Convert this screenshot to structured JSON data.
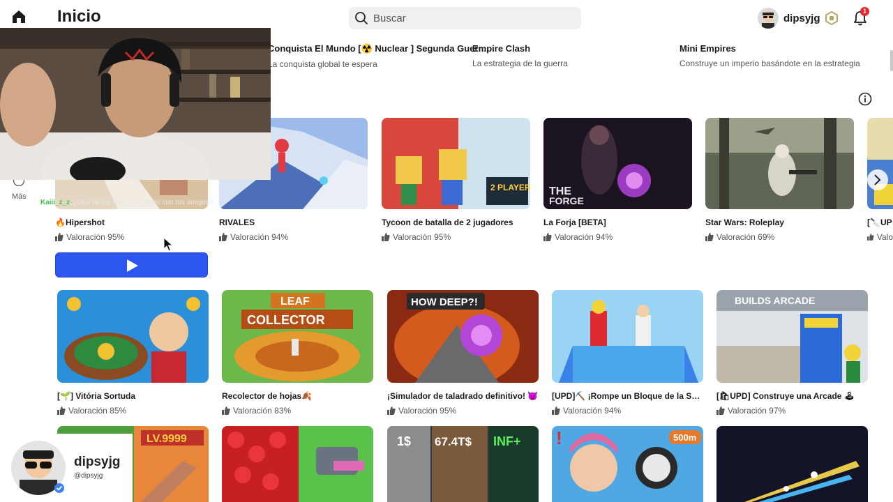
{
  "header": {
    "title": "Inicio",
    "search_placeholder": "Buscar",
    "username": "dipsyjg",
    "notification_count": "1"
  },
  "top_strip": [
    {
      "title": "Conquista El Mundo [☢️ Nuclear ] Segunda Guerr...",
      "subtitle": "La conquista global te espera"
    },
    {
      "title": "Empire Clash",
      "subtitle": "La estrategia de la guerra"
    },
    {
      "title": "Mini Empires",
      "subtitle": "Construye un imperio basándote en la estrategia"
    }
  ],
  "sidebar": {
    "more_label": "Más"
  },
  "chat": {
    "user": "Kaiii_z_z",
    "message": "¿Que tal los dias que saliste con tus amigos?"
  },
  "row1": [
    {
      "title": "🔥Hipershot",
      "rating": "Valoración 95%",
      "colors": [
        "#d9b48a",
        "#f4efe6"
      ]
    },
    {
      "title": "RIVALES",
      "rating": "Valoración 94%",
      "colors": [
        "#4f7fd8",
        "#d8e4f6"
      ]
    },
    {
      "title": "Tycoon de batalla de 2 jugadores",
      "rating": "Valoración 95%",
      "colors": [
        "#d7453c",
        "#f5c84a"
      ]
    },
    {
      "title": "La Forja [BETA]",
      "rating": "Valoración 94%",
      "colors": [
        "#1e1624",
        "#6a3c7e"
      ]
    },
    {
      "title": "Star Wars: Roleplay",
      "rating": "Valoración 69%",
      "colors": [
        "#3e4a3c",
        "#9aa285"
      ]
    },
    {
      "title": "[🔪UP",
      "rating": "Valo",
      "colors": [
        "#e3d7a8",
        "#4a7fd0"
      ]
    }
  ],
  "row2": [
    {
      "title": "[🌱] Vitória Sortuda",
      "rating": "Valoración 85%",
      "colors": [
        "#2b90d9",
        "#f2c230"
      ]
    },
    {
      "title": "Recolector de hojas🍂",
      "rating": "Valoración 83%",
      "colors": [
        "#5aa63f",
        "#e49a2c"
      ]
    },
    {
      "title": "¡Simulador de taladrado definitivo! 😈",
      "rating": "Valoración 95%",
      "colors": [
        "#c3461f",
        "#b246d6"
      ]
    },
    {
      "title": "[UPD]⛏️ ¡Rompe un Bloque de la Suer...",
      "rating": "Valoración 94%",
      "colors": [
        "#7fc8f0",
        "#3b82e8"
      ]
    },
    {
      "title": "[🛍UPD] Construye una Arcade 🕹",
      "rating": "Valoración 97%",
      "colors": [
        "#d9dde2",
        "#2b6bd9"
      ]
    }
  ],
  "row3": [
    {
      "colors": [
        "#e8873a",
        "#4e9e3c"
      ]
    },
    {
      "colors": [
        "#d8262b",
        "#5ac24a"
      ]
    },
    {
      "colors": [
        "#8c8c8c",
        "#2d3a48"
      ]
    },
    {
      "colors": [
        "#4fa8e4",
        "#e06aa4"
      ]
    },
    {
      "colors": [
        "#141428",
        "#e8c84a"
      ]
    }
  ],
  "profile": {
    "name": "dipsyjg",
    "handle": "@dipsyjg"
  }
}
